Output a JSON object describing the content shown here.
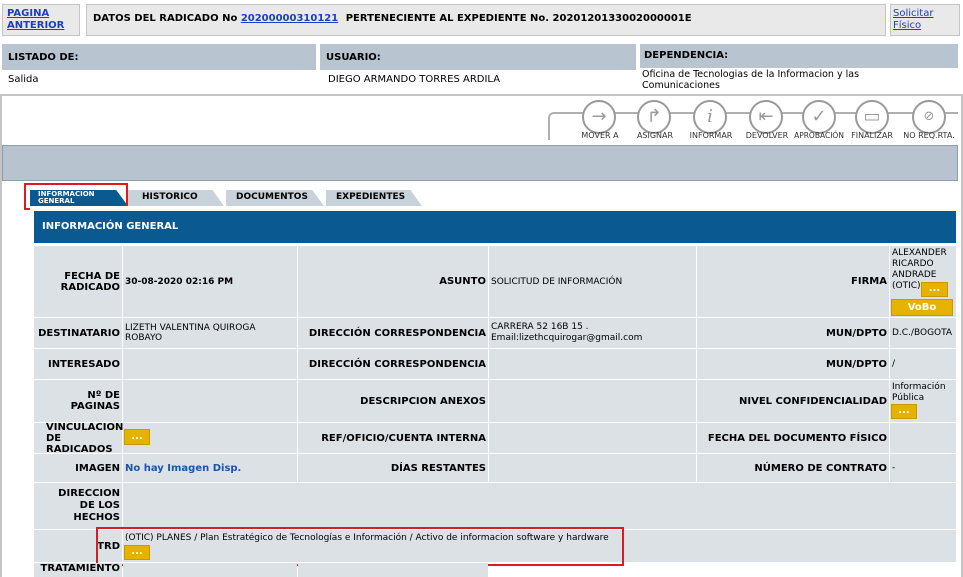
{
  "header": {
    "pagina_anterior": "PAGINA ANTERIOR",
    "datos_prefix": "DATOS DEL RADICADO No",
    "radicado_no": "20200000310121",
    "expediente_text": "PERTENECIENTE AL EXPEDIENTE No. 2020120133002000001E",
    "solicitar_fisico": "Solicitar Físico"
  },
  "info_bar": {
    "listado_label": "LISTADO DE:",
    "listado_value": "Salida",
    "usuario_label": "USUARIO:",
    "usuario_value": "DIEGO ARMANDO TORRES ARDILA",
    "dependencia_label": "DEPENDENCIA:",
    "dependencia_value": "Oficina de Tecnologias de la Informacion y las Comunicaciones"
  },
  "toolbar": {
    "mover": "MOVER A",
    "asignar": "ASIGNAR",
    "informar": "INFORMAR",
    "devolver": "DEVOLVER",
    "aprobacion": "APROBACIÓN",
    "finalizar": "FINALIZAR",
    "no_req": "NO REQ.RTA."
  },
  "tabs": {
    "info_general": "INFORMACION GENERAL",
    "historico": "HISTORICO",
    "documentos": "DOCUMENTOS",
    "expedientes": "EXPEDIENTES"
  },
  "section_title": "INFORMACIÓN GENERAL",
  "fields": {
    "fecha_label": "FECHA DE RADICADO",
    "fecha_value": "30-08-2020 02:16 PM",
    "asunto_label": "ASUNTO",
    "asunto_value": "SOLICITUD DE INFORMACIÓN",
    "firma_label": "FIRMA",
    "firma_value": "ALEXANDER RICARDO ANDRADE (OTIC)",
    "dots": "...",
    "vobo": "VoBo",
    "destinatario_label": "DESTINATARIO",
    "destinatario_value": "LIZETH VALENTINA QUIROGA ROBAYO",
    "direccion_label": "DIRECCIÓN CORRESPONDENCIA",
    "direccion_value": "CARRERA 52 16B 15 . Email:lizethcquirogar@gmail.com",
    "mun_label": "MUN/DPTO",
    "mun_value": "D.C./BOGOTA",
    "interesado_label": "INTERESADO",
    "direccion2_label": "DIRECCIÓN CORRESPONDENCIA",
    "mun2_label": "MUN/DPTO",
    "mun2_value": "/",
    "paginas_label": "Nº DE PAGINAS",
    "anexos_label": "DESCRIPCION ANEXOS",
    "nivel_label": "NIVEL CONFIDENCIALIDAD",
    "nivel_value": "Información Pública",
    "vinculacion_label": "VINCULACION DE RADICADOS",
    "ref_label": "REF/OFICIO/CUENTA INTERNA",
    "fecha_doc_label": "FECHA DEL DOCUMENTO FÍSICO",
    "imagen_label": "IMAGEN",
    "imagen_value": "No hay Imagen Disp.",
    "dias_label": "DÍAS RESTANTES",
    "contrato_label": "NÚMERO DE CONTRATO",
    "contrato_value": "-",
    "hechos_label": "DIRECCION DE LOS HECHOS",
    "trd_label": "TRD",
    "trd_value": "(OTIC) PLANES / Plan Estratégico de Tecnologías e Información / Activo de informacion software y hardware",
    "tratamiento_label": "TRATAMIENTO"
  },
  "colors": {
    "section_header": "#0a5a91",
    "cell_bg": "#dce1e6",
    "button_yellow": "#e6b200",
    "highlight_red": "#d81e1e"
  }
}
